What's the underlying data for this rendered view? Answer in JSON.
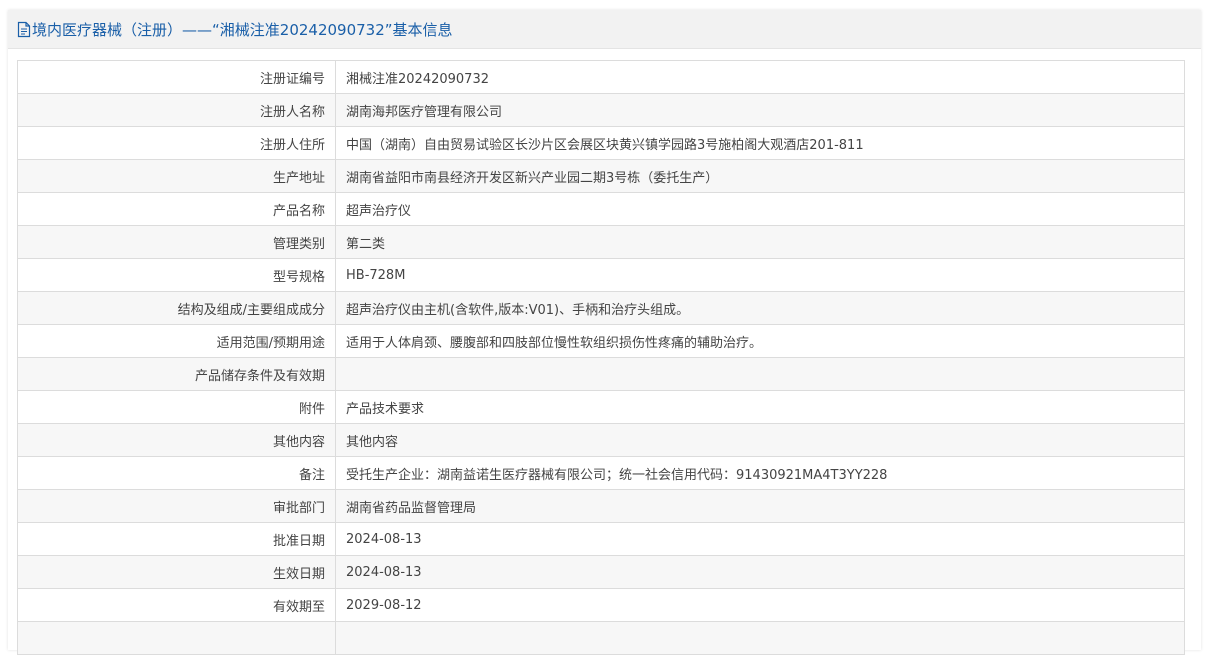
{
  "header": {
    "title": "境内医疗器械（注册）——“湘械注准20242090732”基本信息",
    "icon": "document-icon",
    "color": "#1a5fa8"
  },
  "rows": [
    {
      "label": "注册证编号",
      "value": "湘械注准20242090732"
    },
    {
      "label": "注册人名称",
      "value": "湖南海邦医疗管理有限公司"
    },
    {
      "label": "注册人住所",
      "value": "中国（湖南）自由贸易试验区长沙片区会展区块黄兴镇学园路3号施柏阁大观酒店201-811"
    },
    {
      "label": "生产地址",
      "value": "湖南省益阳市南县经济开发区新兴产业园二期3号栋（委托生产）"
    },
    {
      "label": "产品名称",
      "value": "超声治疗仪"
    },
    {
      "label": "管理类别",
      "value": "第二类"
    },
    {
      "label": "型号规格",
      "value": "HB-728M"
    },
    {
      "label": "结构及组成/主要组成成分",
      "value": "超声治疗仪由主机(含软件,版本:V01)、手柄和治疗头组成。"
    },
    {
      "label": "适用范围/预期用途",
      "value": "适用于人体肩颈、腰腹部和四肢部位慢性软组织损伤性疼痛的辅助治疗。"
    },
    {
      "label": "产品储存条件及有效期",
      "value": ""
    },
    {
      "label": "附件",
      "value": "产品技术要求"
    },
    {
      "label": "其他内容",
      "value": "其他内容"
    },
    {
      "label": "备注",
      "value": "受托生产企业：湖南益诺生医疗器械有限公司；统一社会信用代码：91430921MA4T3YY228"
    },
    {
      "label": "审批部门",
      "value": "湖南省药品监督管理局"
    },
    {
      "label": "批准日期",
      "value": "2024-08-13"
    },
    {
      "label": "生效日期",
      "value": "2024-08-13"
    },
    {
      "label": "有效期至",
      "value": "2029-08-12"
    },
    {
      "label": "",
      "value": ""
    }
  ]
}
